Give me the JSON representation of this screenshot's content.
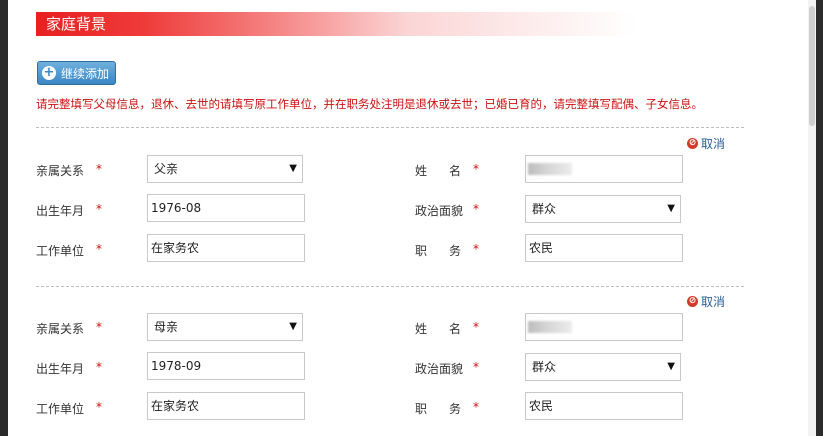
{
  "section": {
    "title": "家庭背景"
  },
  "actions": {
    "add_label": "继续添加"
  },
  "notice": "请完整填写父母信息，退休、去世的请填写原工作单位，并在职务处注明是退休或去世；已婚已育的，请完整填写配偶、子女信息。",
  "labels": {
    "relation": "亲属关系",
    "name": "姓名",
    "birth": "出生年月",
    "political": "政治面貌",
    "work": "工作单位",
    "position": "职务",
    "required": "*",
    "cancel": "取消"
  },
  "members": [
    {
      "relation": "父亲",
      "birth": "1976-08",
      "political": "群众",
      "work": "在家务农",
      "position": "农民"
    },
    {
      "relation": "母亲",
      "birth": "1978-09",
      "political": "群众",
      "work": "在家务农",
      "position": "农民"
    }
  ],
  "icons": {
    "add": "plus-circle-icon",
    "cancel": "no-entry-icon",
    "dropdown": "caret-down-icon"
  },
  "colors": {
    "header_red": "#e8201f",
    "required_red": "#cc1111",
    "button_blue": "#3a86c4",
    "link_blue": "#2a5d96"
  }
}
